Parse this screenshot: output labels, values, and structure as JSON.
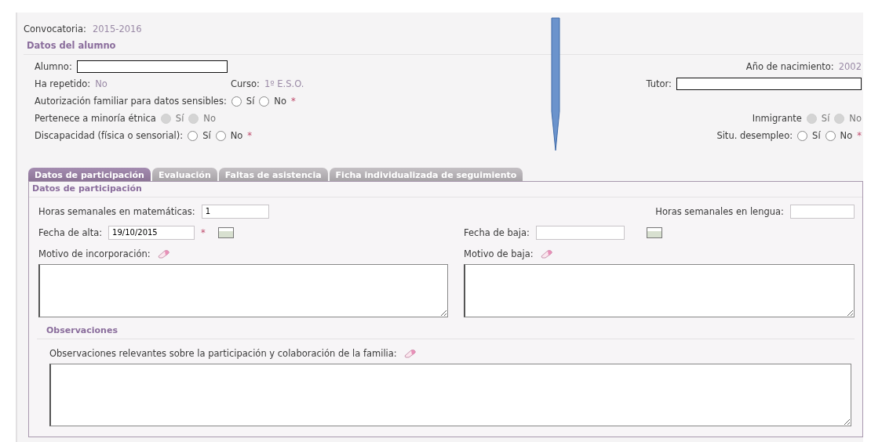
{
  "convocatoria": {
    "label": "Convocatoria:",
    "value": "2015-2016"
  },
  "student_section": {
    "title": "Datos del alumno",
    "alumno": {
      "label": "Alumno:"
    },
    "birth_year": {
      "label": "Año de nacimiento:",
      "value": "2002"
    },
    "repeated": {
      "label": "Ha repetido:",
      "value": "No"
    },
    "course": {
      "label": "Curso:",
      "value": "1º E.S.O."
    },
    "tutor": {
      "label": "Tutor:"
    },
    "question_rows": [
      {
        "left": {
          "label": "Autorización familiar para datos sensibles:",
          "disabled": false,
          "options": [
            {
              "label": "Sí",
              "selected": false
            },
            {
              "label": "No",
              "selected": false
            }
          ],
          "mark": "*"
        }
      },
      {
        "left": {
          "label": "Pertenece a minoría étnica",
          "disabled": true,
          "options": [
            {
              "label": "Sí",
              "selected": false
            },
            {
              "label": "No",
              "selected": false
            }
          ]
        },
        "right": {
          "label": "Inmigrante",
          "disabled": true,
          "options": [
            {
              "label": "Sí",
              "selected": false
            },
            {
              "label": "No",
              "selected": false
            }
          ]
        }
      },
      {
        "left": {
          "label": "Discapacidad (física o sensorial):",
          "disabled": false,
          "options": [
            {
              "label": "Sí",
              "selected": false
            },
            {
              "label": "No",
              "selected": false
            }
          ],
          "mark": "*"
        },
        "right": {
          "label": "Situ. desempleo:",
          "disabled": false,
          "options": [
            {
              "label": "Sí",
              "selected": false
            },
            {
              "label": "No",
              "selected": false
            }
          ],
          "mark": "*"
        }
      }
    ]
  },
  "tabs": [
    {
      "label": "Datos de participación",
      "selected": true
    },
    {
      "label": "Evaluación",
      "selected": false
    },
    {
      "label": "Faltas de asistencia",
      "selected": false
    },
    {
      "label": "Ficha individualizada de seguimiento",
      "selected": false
    }
  ],
  "participation": {
    "title": "Datos de participación",
    "hours_math": {
      "label": "Horas semanales en matemáticas:",
      "value": "1"
    },
    "hours_language": {
      "label": "Horas semanales en lengua:"
    },
    "start_date": {
      "label": "Fecha de alta:",
      "value": "19/10/2015",
      "mark": "*"
    },
    "end_date": {
      "label": "Fecha de baja:"
    },
    "reason_joined": {
      "label": "Motivo de incorporación:"
    },
    "reason_left": {
      "label": "Motivo de baja:"
    },
    "observations": {
      "title": "Observaciones",
      "label": "Observaciones relevantes sobre la participación y colaboración de la familia:"
    }
  }
}
